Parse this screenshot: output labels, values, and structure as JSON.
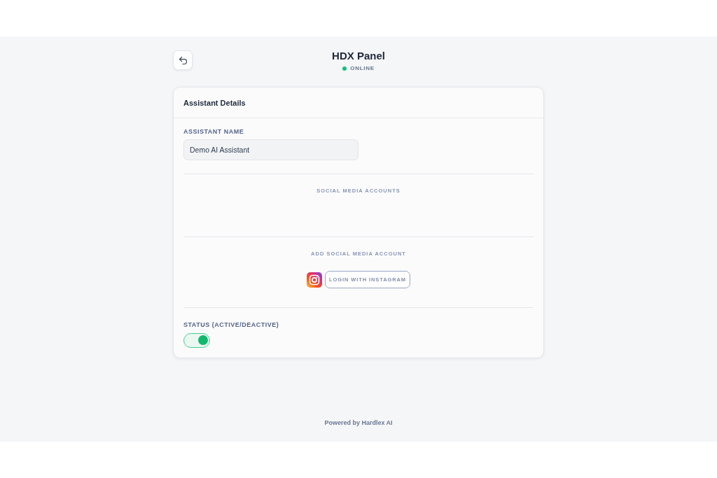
{
  "header": {
    "title": "HDX Panel",
    "status": {
      "label": "ONLINE",
      "online": true
    }
  },
  "card": {
    "title": "Assistant Details",
    "name_field": {
      "label": "ASSISTANT NAME",
      "value": "Demo AI Assistant"
    },
    "accounts": {
      "heading": "SOCIAL MEDIA ACCOUNTS"
    },
    "add_account": {
      "heading": "ADD SOCIAL MEDIA ACCOUNT",
      "logins": [
        {
          "kind": "instagram",
          "label": "LOGIN WITH INSTAGRAM"
        }
      ]
    },
    "status_toggle": {
      "label": "STATUS (ACTIVE/DEACTIVE)",
      "on": true
    }
  },
  "footer": "Powered by Hardlex AI"
}
